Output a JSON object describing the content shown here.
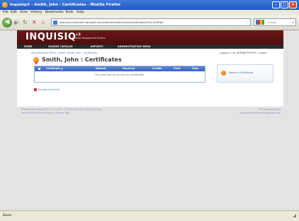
{
  "window": {
    "title": "Inquisiq® - Smith, John : Certificates - Mozilla Firefox",
    "min_glyph": "–",
    "max_glyph": "□",
    "close_glyph": "✕"
  },
  "menu": [
    "File",
    "Edit",
    "View",
    "History",
    "Bookmarks",
    "Tools",
    "Help"
  ],
  "toolbar": {
    "back_glyph": "◀",
    "forward_glyph": "▶",
    "reload_glyph": "↻",
    "stop_glyph": "✕",
    "home_glyph": "⌂",
    "url": "http://kcr.evolved.inquisiq3.com/administrator/users/certificates/?id=4169#2",
    "star_glyph": "☆",
    "search_placeholder": "Google",
    "search_glyph": "⌕"
  },
  "site": {
    "logo": "INQUISIQ",
    "logo_sup": "r3",
    "logo_sub": "Learning Management System",
    "nav": [
      "HOME",
      "COURSE CATALOG",
      "REPORTS",
      "ADMINISTRATION MENU"
    ],
    "breadcrumb": "Administrative Menu : Users : Smith, John : Certificates",
    "login_info": "Logged in as: ADMINISTRATOR | Logout",
    "page_heading": "Smith, John : Certificates"
  },
  "table": {
    "columns": [
      "Certificate ▲",
      "Method",
      "Received",
      "Credits",
      "Print",
      "View"
    ],
    "empty_message": "This user has not earned any certificates."
  },
  "actions": {
    "revoke_label": "Revoke Selected",
    "award_label": "Award a Certificate"
  },
  "footer": {
    "left_line1": "Powered by Inquisiq® R3 v.3.1.123 - © 2002-2011 ICS Learning Group",
    "left_line2": "Terms of Use | Privacy Policy | System Test",
    "right_line1": "ICS Learning Group",
    "right_line2": "jason.snorey@icslearninggroup.com"
  },
  "status": {
    "text": "Done",
    "grip_glyph": "◢"
  },
  "colors": {
    "brand_maroon": "#5a1212",
    "table_header_blue": "#3f6cc6",
    "link_blue": "#4f6fb4",
    "window_blue": "#2f67d8"
  }
}
